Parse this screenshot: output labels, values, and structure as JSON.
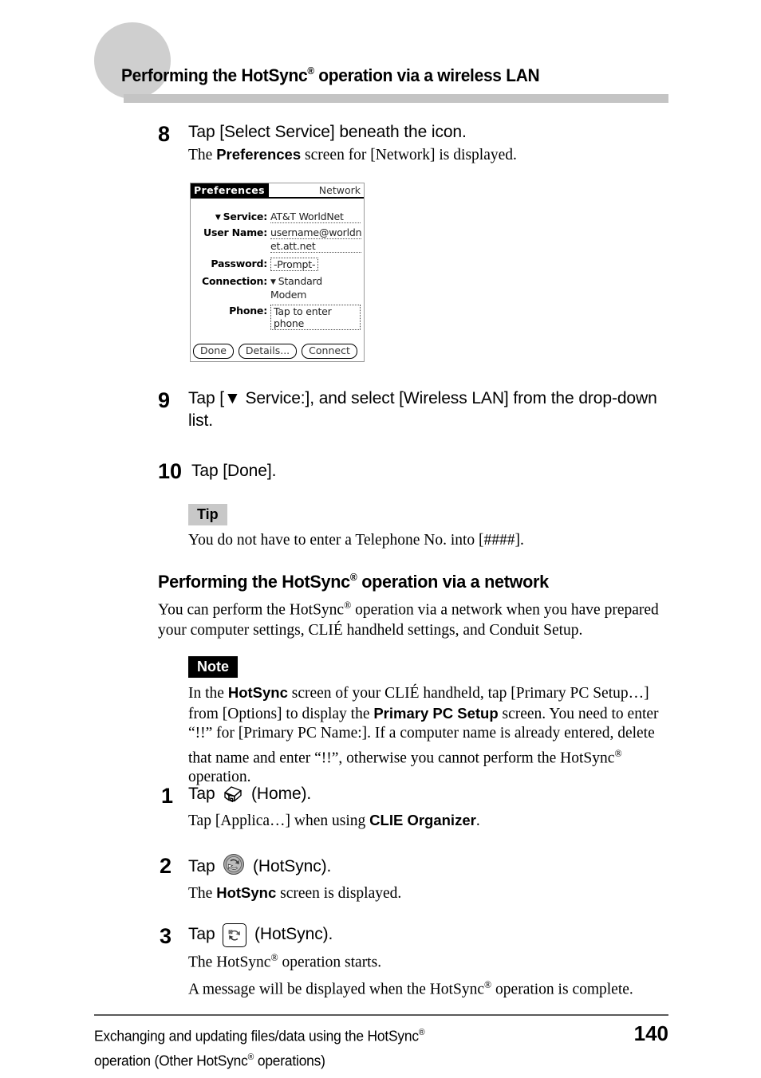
{
  "header": {
    "title_before": "Performing the HotSync",
    "title_sup": "®",
    "title_after": " operation via a wireless LAN"
  },
  "steps": [
    {
      "number": "8",
      "title": "Tap [Select Service] beneath the icon.",
      "sub_before": "The ",
      "sub_bold": "Preferences",
      "sub_after": " screen for [Network] is displayed."
    },
    {
      "number": "9",
      "title": "Tap [▼ Service:], and select [Wireless LAN] from the drop-down list."
    },
    {
      "number": "10",
      "title": "Tap [Done]."
    },
    {
      "number": "1",
      "title_before": "Tap ",
      "icon": "home-icon",
      "title_after": " (Home).",
      "sub_before": "Tap [Applica…] when using ",
      "sub_bold": "CLIE Organizer",
      "sub_after": "."
    },
    {
      "number": "2",
      "title_before": "Tap ",
      "icon": "hotsync-icon",
      "title_after": " (HotSync).",
      "sub_before": "The ",
      "sub_bold": "HotSync",
      "sub_after": " screen is displayed."
    },
    {
      "number": "3",
      "title_before": "Tap ",
      "icon": "hotsync-button-icon",
      "title_after": " (HotSync).",
      "sub_line1_before": "The HotSync",
      "sub_line1_sup": "®",
      "sub_line1_after": " operation starts.",
      "sub_line2_before": "A message will be displayed when the HotSync",
      "sub_line2_sup": "®",
      "sub_line2_after": " operation is complete."
    }
  ],
  "pda": {
    "title_tab": "Preferences",
    "title_right": "Network",
    "fields": [
      {
        "label": "Service:",
        "has_triangle": true,
        "value": "AT&T WorldNet",
        "style": "dotline"
      },
      {
        "label": "User Name:",
        "has_triangle": false,
        "value": "username@worldn",
        "value_line2": "et.att.net",
        "style": "dotline2"
      },
      {
        "label": "Password:",
        "has_triangle": false,
        "value": "-Prompt-",
        "style": "dotbox"
      },
      {
        "label": "Connection:",
        "has_triangle": true,
        "value": "Standard Modem",
        "style": "plain"
      },
      {
        "label": "Phone:",
        "has_triangle": false,
        "value": "Tap to enter phone",
        "style": "dotbox-wide"
      }
    ],
    "buttons": [
      "Done",
      "Details...",
      "Connect"
    ]
  },
  "tip": {
    "badge": "Tip",
    "text": "You do not have to enter a Telephone No. into [####]."
  },
  "section": {
    "heading_before": "Performing the HotSync",
    "heading_sup": "®",
    "heading_after": " operation via a network",
    "para_before": "You can perform the HotSync",
    "para_sup": "®",
    "para_after": " operation via a network when you have prepared your computer settings, CLIÉ handheld settings, and Conduit Setup."
  },
  "note": {
    "badge": "Note",
    "p1_before": "In the ",
    "p1_bold": "HotSync",
    "p1_mid": " screen of your CLIÉ handheld, tap [Primary PC Setup…] from [Options] to display the ",
    "p1_bold2": "Primary PC Setup",
    "p1_after": " screen. You need to enter “!!” for [Primary PC Name:]. If a computer name is already entered, delete that name and enter “!!”, otherwise you cannot perform the HotSync",
    "p1_sup": "®",
    "p1_end": " operation."
  },
  "footer": {
    "line1_before": "Exchanging and updating files/data using the HotSync",
    "line1_sup": "®",
    "line2_before": "operation (Other HotSync",
    "line2_sup": "®",
    "line2_after": " operations)",
    "page_number": "140"
  },
  "colors": {
    "header_circle": "#cfcfcf",
    "header_bar": "#c4c4c4",
    "tip_badge_bg": "#c8c8c8",
    "note_badge_bg": "#000000",
    "footer_rule": "#5a5a5a"
  }
}
